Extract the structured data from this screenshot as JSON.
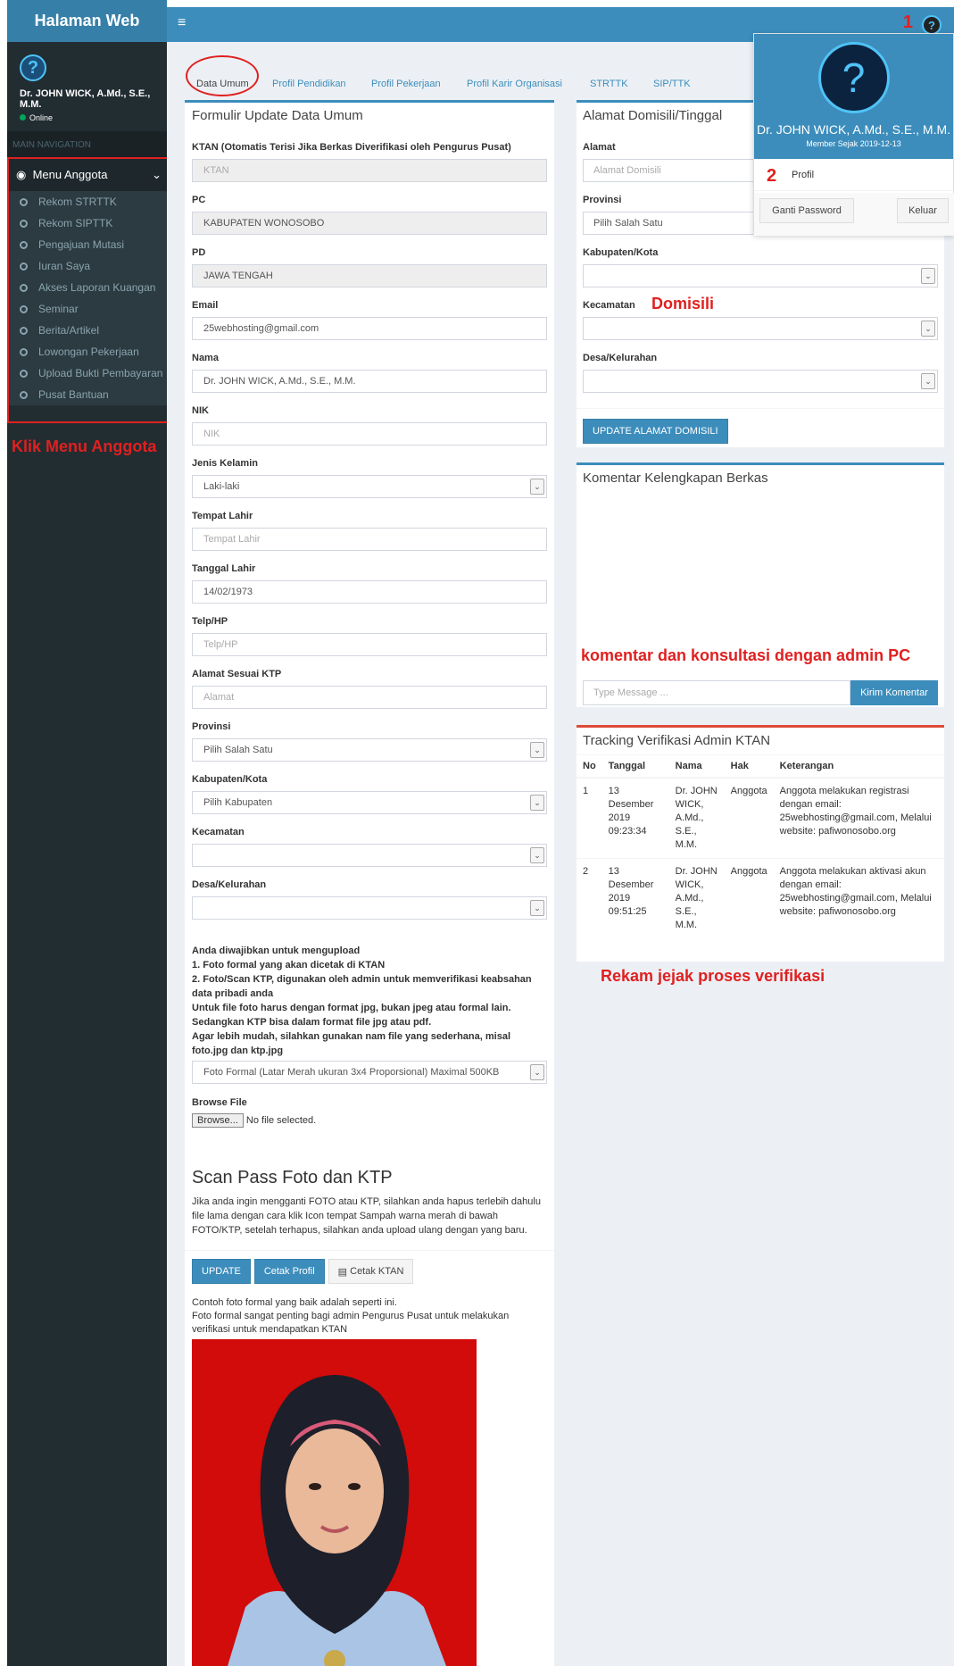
{
  "brand": "Halaman Web",
  "sidebar": {
    "user_name": "Dr. JOHN WICK, A.Md., S.E., M.M.",
    "status": "Online",
    "nav_header": "MAIN NAVIGATION",
    "menu_label": "Menu Anggota",
    "items": [
      "Rekom STRTTK",
      "Rekom SIPTTK",
      "Pengajuan Mutasi",
      "Iuran Saya",
      "Akses Laporan Kuangan",
      "Seminar",
      "Berita/Artikel",
      "Lowongan Pekerjaan",
      "Upload Bukti Pembayaran",
      "Pusat Bantuan"
    ],
    "annotation": "Klik Menu Anggota"
  },
  "topbar": {
    "hamburger": "≡",
    "annotation_number": "1"
  },
  "tabs": [
    "Data Umum",
    "Profil Pendidikan",
    "Profil Pekerjaan",
    "Profil Karir Organisasi",
    "STRTTK",
    "SIP/TTK"
  ],
  "form": {
    "title": "Formulir Update Data Umum",
    "ktan_label": "KTAN (Otomatis Terisi Jika Berkas Diverifikasi oleh Pengurus Pusat)",
    "ktan_placeholder": "KTAN",
    "pc_label": "PC",
    "pc_value": "KABUPATEN WONOSOBO",
    "pd_label": "PD",
    "pd_value": "JAWA TENGAH",
    "email_label": "Email",
    "email_value": "25webhosting@gmail.com",
    "nama_label": "Nama",
    "nama_value": "Dr. JOHN WICK, A.Md., S.E., M.M.",
    "nik_label": "NIK",
    "nik_placeholder": "NIK",
    "jk_label": "Jenis Kelamin",
    "jk_value": "Laki-laki",
    "tempat_label": "Tempat Lahir",
    "tempat_placeholder": "Tempat Lahir",
    "tanggal_label": "Tanggal Lahir",
    "tanggal_value": "14/02/1973",
    "telp_label": "Telp/HP",
    "telp_placeholder": "Telp/HP",
    "alamat_label": "Alamat Sesuai KTP",
    "alamat_placeholder": "Alamat",
    "provinsi_label": "Provinsi",
    "provinsi_value": "Pilih Salah Satu",
    "kab_label": "Kabupaten/Kota",
    "kab_value": "Pilih Kabupaten",
    "kec_label": "Kecamatan",
    "desa_label": "Desa/Kelurahan",
    "notes": [
      "Anda diwajibkan untuk mengupload",
      "1. Foto formal yang akan dicetak di KTAN",
      "2. Foto/Scan KTP, digunakan oleh admin untuk memverifikasi keabsahan data pribadi anda",
      "Untuk file foto harus dengan format jpg, bukan jpeg atau formal lain. Sedangkan KTP bisa dalam format file jpg atau pdf.",
      "Agar lebih mudah, silahkan gunakan nam file yang sederhana, misal foto.jpg dan ktp.jpg"
    ],
    "upload_select": "Foto Formal (Latar Merah ukuran 3x4 Proporsional) Maximal 500KB",
    "browse_label": "Browse File",
    "browse_button": "Browse...",
    "no_file": "No file selected.",
    "scan_title": "Scan Pass Foto dan KTP",
    "scan_text": "Jika anda ingin mengganti FOTO atau KTP, silahkan anda hapus terlebih dahulu file lama dengan cara klik Icon tempat Sampah warna merah di bawah FOTO/KTP, setelah terhapus, silahkan anda upload ulang dengan yang baru.",
    "btn_update": "UPDATE",
    "btn_cetak_profil": "Cetak Profil",
    "btn_cetak_ktan": "Cetak KTAN",
    "contoh_1": "Contoh foto formal yang baik adalah seperti ini.",
    "contoh_2": "Foto formal sangat penting bagi admin Pengurus Pusat untuk melakukan verifikasi untuk mendapatkan KTAN"
  },
  "domisili": {
    "title": "Alamat Domisili/Tinggal",
    "alamat_label": "Alamat",
    "alamat_placeholder": "Alamat Domisili",
    "provinsi_label": "Provinsi",
    "provinsi_value": "Pilih Salah Satu",
    "kab_label": "Kabupaten/Kota",
    "kec_label": "Kecamatan",
    "desa_label": "Desa/Kelurahan",
    "button": "UPDATE ALAMAT DOMISILI",
    "annotation": "Domisili"
  },
  "komentar": {
    "title": "Komentar Kelengkapan Berkas",
    "placeholder": "Type Message ...",
    "button": "Kirim Komentar",
    "annotation": "komentar dan konsultasi dengan admin PC"
  },
  "tracking": {
    "title": "Tracking Verifikasi Admin KTAN",
    "headers": [
      "No",
      "Tanggal",
      "Nama",
      "Hak",
      "Keterangan"
    ],
    "rows": [
      {
        "no": "1",
        "tanggal": "13 Desember 2019 09:23:34",
        "nama": "Dr. JOHN WICK, A.Md., S.E., M.M.",
        "hak": "Anggota",
        "ket": "Anggota melakukan registrasi dengan email: 25webhosting@gmail.com, Melalui website: pafiwonosobo.org"
      },
      {
        "no": "2",
        "tanggal": "13 Desember 2019 09:51:25",
        "nama": "Dr. JOHN WICK, A.Md., S.E., M.M.",
        "hak": "Anggota",
        "ket": "Anggota melakukan aktivasi akun dengan email: 25webhosting@gmail.com, Melalui website: pafiwonosobo.org"
      }
    ],
    "annotation": "Rekam jejak proses verifikasi"
  },
  "dropdown": {
    "name": "Dr. JOHN WICK, A.Md., S.E., M.M.",
    "member_since": "Member Sejak 2019-12-13",
    "annotation_number": "2",
    "profil": "Profil",
    "ganti_password": "Ganti Password",
    "keluar": "Keluar"
  },
  "colors": {
    "primary": "#3c8dbc",
    "sidebar": "#222d32",
    "annotation": "#e02020"
  }
}
